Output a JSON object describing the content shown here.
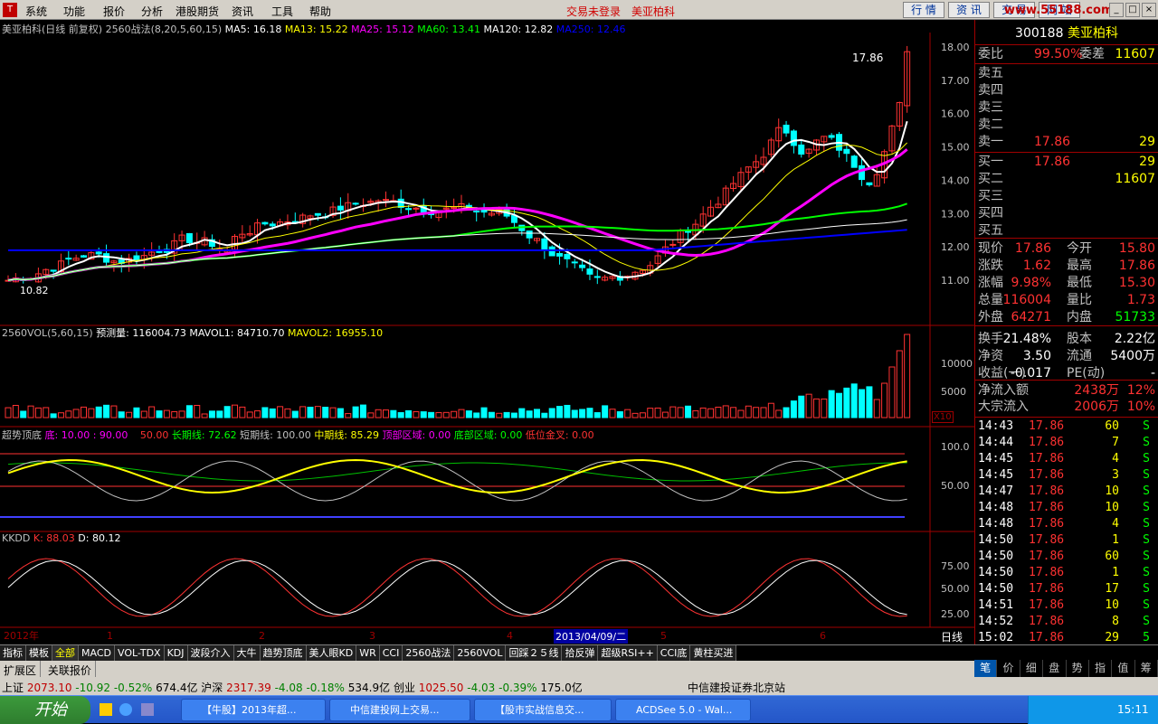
{
  "menu": {
    "items": [
      "系统",
      "功能",
      "报价",
      "分析",
      "港股期货",
      "资讯",
      "工具",
      "帮助"
    ],
    "red_items": [
      "交易未登录",
      "美亚柏科"
    ],
    "buttons": [
      "行 情",
      "资 讯",
      "交 易",
      "网 站"
    ],
    "site": "www.55188.com"
  },
  "main_panel": {
    "header": "美亚柏科(日线 前复权) 2560战法(8,20,5,60,15)",
    "ma5": "MA5: 16.18",
    "ma13": "MA13: 15.22",
    "ma25": "MA25: 15.12",
    "ma60": "MA60: 13.41",
    "ma120": "MA120: 12.82",
    "ma250": "MA250: 12.46",
    "high_label": "17.86",
    "low_label": "10.82",
    "price_axis": [
      "18.00",
      "17.00",
      "16.00",
      "15.00",
      "14.00",
      "13.00",
      "12.00",
      "11.00"
    ],
    "colors": {
      "ma5": "#ffffff",
      "ma13": "#ffff00",
      "ma25": "#ff00ff",
      "ma60": "#00ff00",
      "ma120": "#ffffff",
      "ma250": "#0000ff",
      "up": "#ff3232",
      "down": "#00ffff"
    }
  },
  "vol_panel": {
    "title": "2560VOL(5,60,15)",
    "forecast": "预测量: 116004.73",
    "mavol1": "MAVOL1: 84710.70",
    "mavol2": "MAVOL2: 16955.10",
    "axis": [
      "10000",
      "5000"
    ],
    "unit": "X10"
  },
  "trend_panel": {
    "title": "超势顶底",
    "bottom": "底: 10.00",
    "v90": ": 90.00",
    "v50": "50.00",
    "long": "长期线: 72.62",
    "short": "短期线: 100.00",
    "mid": "中期线: 85.29",
    "top_zone": "顶部区域: 0.00",
    "bottom_zone": "底部区域: 0.00",
    "low_cross": "低位金叉: 0.00",
    "axis": [
      "100.0",
      "50.00"
    ]
  },
  "kdj_panel": {
    "title": "KKDD",
    "k": "K: 88.03",
    "d": "D: 80.12",
    "axis": [
      "75.00",
      "50.00",
      "25.00"
    ]
  },
  "time_axis": {
    "labels": [
      "2012年",
      "1",
      "2",
      "3",
      "4",
      "5",
      "6"
    ],
    "selected_date": "2013/04/09/二",
    "period": "日线"
  },
  "indicator_tabs": [
    "指标",
    "模板",
    "全部",
    "MACD",
    "VOL-TDX",
    "KDJ",
    "波段介入",
    "大牛",
    "趋势顶底",
    "美人眼KD",
    "WR",
    "CCI",
    "2560战法",
    "2560VOL",
    "回踩２５线",
    "拾反弹",
    "超级RSI++",
    "CCI底",
    "黄柱买进"
  ],
  "sub_tabs": [
    "扩展区",
    "关联报价"
  ],
  "stock": {
    "code": "300188",
    "name": "美亚柏科",
    "weibi_label": "委比",
    "weibi": "99.50%",
    "weicha_label": "委差",
    "weicha": "11607"
  },
  "orderbook": {
    "sell": [
      {
        "label": "卖五",
        "price": "",
        "vol": ""
      },
      {
        "label": "卖四",
        "price": "",
        "vol": ""
      },
      {
        "label": "卖三",
        "price": "",
        "vol": ""
      },
      {
        "label": "卖二",
        "price": "",
        "vol": ""
      },
      {
        "label": "卖一",
        "price": "17.86",
        "vol": "29"
      }
    ],
    "buy": [
      {
        "label": "买一",
        "price": "17.86",
        "vol": "29"
      },
      {
        "label": "买二",
        "price": "",
        "vol": "11607"
      },
      {
        "label": "买三",
        "price": "",
        "vol": ""
      },
      {
        "label": "买四",
        "price": "",
        "vol": ""
      },
      {
        "label": "买五",
        "price": "",
        "vol": ""
      }
    ]
  },
  "quote": [
    {
      "l1": "现价",
      "v1": "17.86",
      "l2": "今开",
      "v2": "15.80"
    },
    {
      "l1": "涨跌",
      "v1": "1.62",
      "l2": "最高",
      "v2": "17.86"
    },
    {
      "l1": "涨幅",
      "v1": "9.98%",
      "l2": "最低",
      "v2": "15.30"
    },
    {
      "l1": "总量",
      "v1": "116004",
      "l2": "量比",
      "v2": "1.73"
    },
    {
      "l1": "外盘",
      "v1": "64271",
      "l2": "内盘",
      "v2": "51733"
    },
    {
      "l1": "换手",
      "v1": "21.48%",
      "l2": "股本",
      "v2": "2.22亿"
    },
    {
      "l1": "净资",
      "v1": "3.50",
      "l2": "流通",
      "v2": "5400万"
    },
    {
      "l1": "收益(一)",
      "v1": "-0.017",
      "l2": "PE(动)",
      "v2": "-"
    }
  ],
  "flow": [
    {
      "label": "净流入额",
      "v1": "2438万",
      "v2": "12%"
    },
    {
      "label": "大宗流入",
      "v1": "2006万",
      "v2": "10%"
    }
  ],
  "ticks": [
    {
      "t": "14:43",
      "p": "17.86",
      "v": "60",
      "s": "S"
    },
    {
      "t": "14:44",
      "p": "17.86",
      "v": "7",
      "s": "S"
    },
    {
      "t": "14:45",
      "p": "17.86",
      "v": "4",
      "s": "S"
    },
    {
      "t": "14:45",
      "p": "17.86",
      "v": "3",
      "s": "S"
    },
    {
      "t": "14:47",
      "p": "17.86",
      "v": "10",
      "s": "S"
    },
    {
      "t": "14:48",
      "p": "17.86",
      "v": "10",
      "s": "S"
    },
    {
      "t": "14:48",
      "p": "17.86",
      "v": "4",
      "s": "S"
    },
    {
      "t": "14:50",
      "p": "17.86",
      "v": "1",
      "s": "S"
    },
    {
      "t": "14:50",
      "p": "17.86",
      "v": "60",
      "s": "S"
    },
    {
      "t": "14:50",
      "p": "17.86",
      "v": "1",
      "s": "S"
    },
    {
      "t": "14:50",
      "p": "17.86",
      "v": "17",
      "s": "S"
    },
    {
      "t": "14:51",
      "p": "17.86",
      "v": "10",
      "s": "S"
    },
    {
      "t": "14:52",
      "p": "17.86",
      "v": "8",
      "s": "S"
    },
    {
      "t": "15:02",
      "p": "17.86",
      "v": "29",
      "s": "5"
    }
  ],
  "right_tabs": [
    "笔",
    "价",
    "细",
    "盘",
    "势",
    "指",
    "值",
    "筹"
  ],
  "status": {
    "sh": "上证",
    "sh_v": "2073.10",
    "sh_c": "-10.92",
    "sh_p": "-0.52%",
    "sh_a": "674.4亿",
    "sz": "沪深",
    "sz_v": "2317.39",
    "sz_c": "-4.08",
    "sz_p": "-0.18%",
    "sz_a": "534.9亿",
    "cy": "创业",
    "cy_v": "1025.50",
    "cy_c": "-4.03",
    "cy_p": "-0.39%",
    "cy_a": "175.0亿",
    "broker": "中信建投证券北京站"
  },
  "taskbar": {
    "start": "开始",
    "tasks": [
      "【牛股】2013年超...",
      "中信建投网上交易...",
      "【股市实战信息交...",
      "ACDSee 5.0 - Wal..."
    ],
    "clock": "15:11"
  }
}
